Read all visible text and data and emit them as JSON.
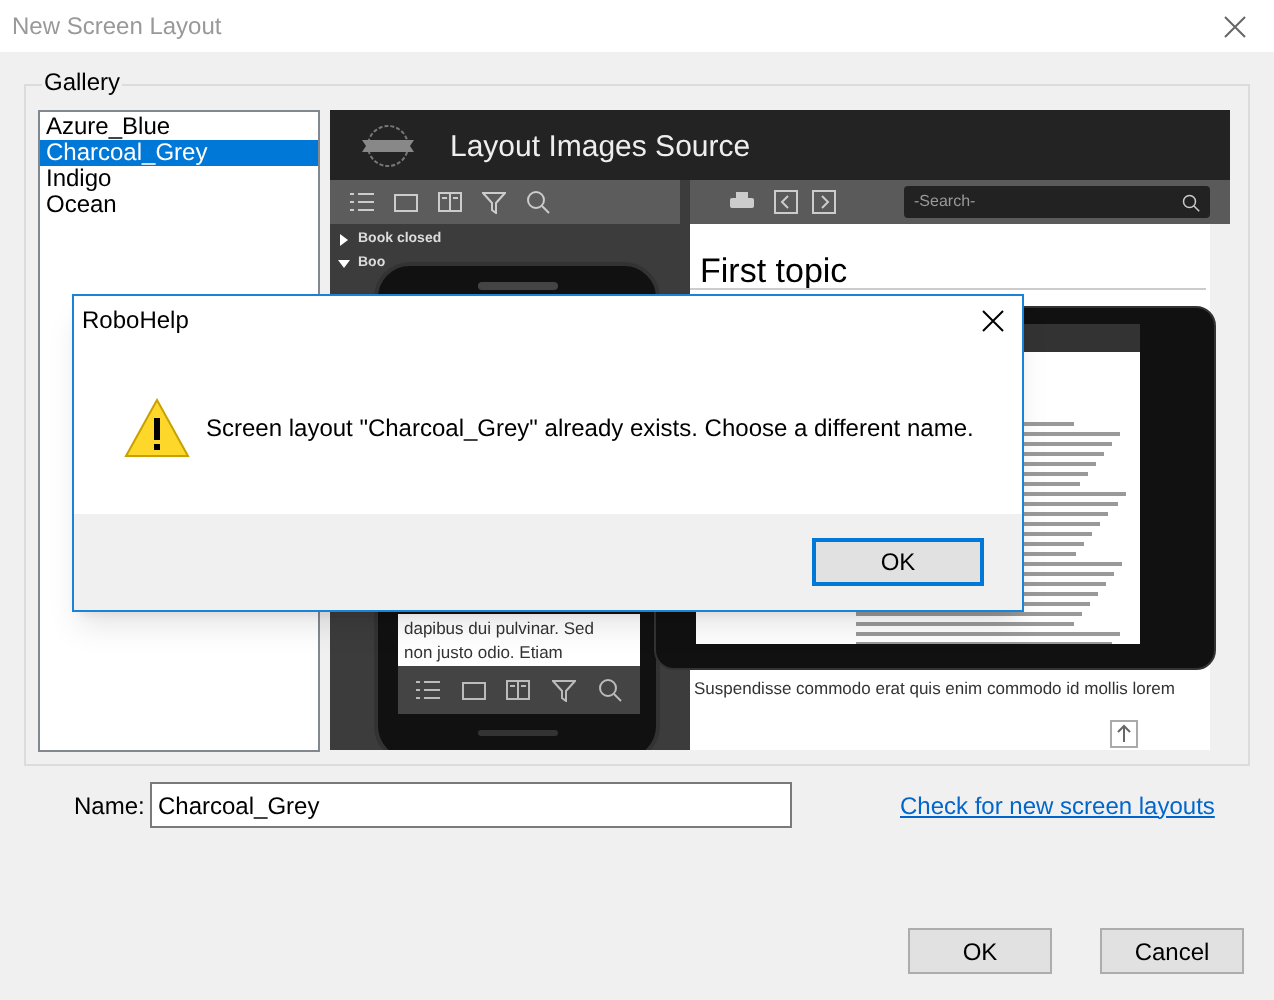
{
  "window": {
    "title": "New Screen Layout"
  },
  "gallery": {
    "label": "Gallery",
    "items": [
      {
        "label": "Azure_Blue",
        "selected": false
      },
      {
        "label": "Charcoal_Grey",
        "selected": true
      },
      {
        "label": "Indigo",
        "selected": false
      },
      {
        "label": "Ocean",
        "selected": false
      }
    ]
  },
  "preview": {
    "header": "Layout Images Source",
    "search_placeholder": "-Search-",
    "toc": [
      {
        "label": "Book closed",
        "expanded": false
      },
      {
        "label": "Boo",
        "expanded": true
      }
    ],
    "topic_title": "First topic",
    "phone_text": [
      "dapibus dui pulvinar. Sed",
      "non justo odio. Etiam"
    ],
    "body_text": "Suspendisse commodo erat quis enim commodo id mollis lorem"
  },
  "name_field": {
    "label": "Name:",
    "value": "Charcoal_Grey"
  },
  "link": "Check for new screen layouts",
  "buttons": [
    "OK",
    "Cancel"
  ],
  "alert": {
    "title": "RoboHelp",
    "message": "Screen layout \"Charcoal_Grey\" already exists. Choose a different name.",
    "button": "OK"
  }
}
